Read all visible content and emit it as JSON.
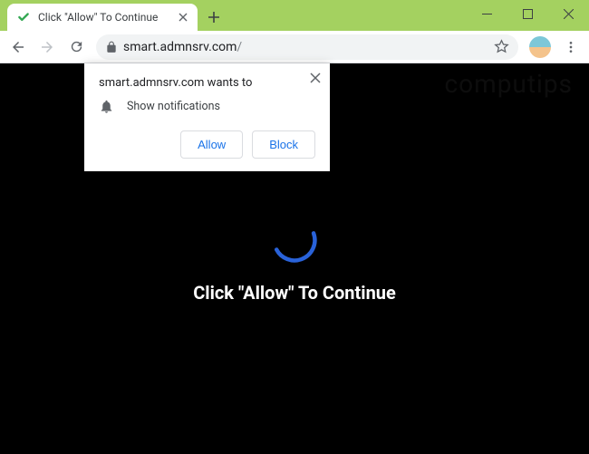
{
  "window": {
    "watermark": "computips"
  },
  "tab": {
    "title": "Click \"Allow\" To Continue"
  },
  "address": {
    "domain": "smart.admnsrv.com",
    "path": "/"
  },
  "permission": {
    "prompt": "smart.admnsrv.com wants to",
    "description": "Show notifications",
    "allow_label": "Allow",
    "block_label": "Block"
  },
  "page": {
    "main_text": "Click \"Allow\" To Continue"
  }
}
